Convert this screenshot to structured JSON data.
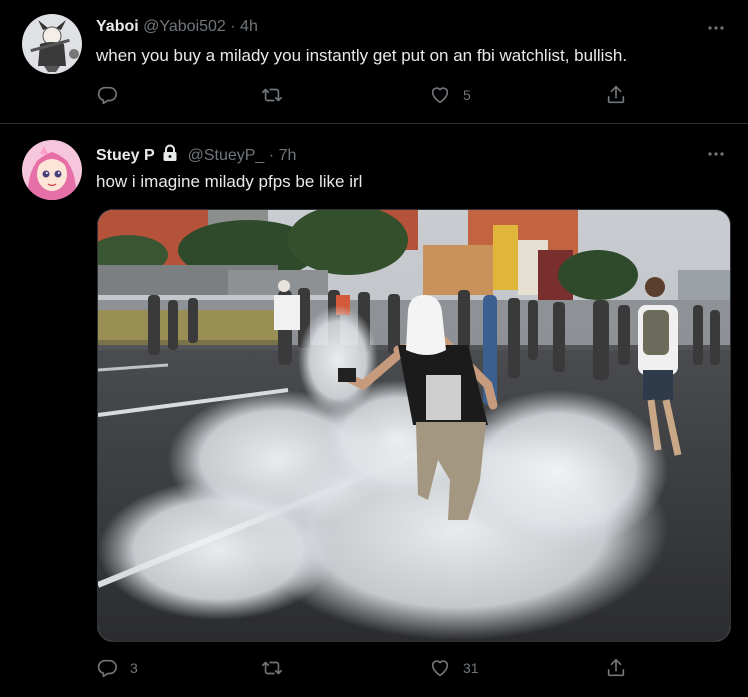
{
  "tweets": [
    {
      "author_name": "Yaboi",
      "handle": "@Yaboi502",
      "separator": "·",
      "time": "4h",
      "text": "when you buy a milady you instantly get put on an fbi watchlist, bullish.",
      "counts": {
        "reply": "",
        "retweet": "",
        "like": "5",
        "share": ""
      },
      "verified_lock": false
    },
    {
      "author_name": "Stuey P",
      "handle": "@StueyP_",
      "separator": "·",
      "time": "7h",
      "text": "how i imagine milady pfps be like irl",
      "counts": {
        "reply": "3",
        "retweet": "",
        "like": "31",
        "share": ""
      },
      "verified_lock": true
    }
  ],
  "icons": {
    "more": "more-horizontal-icon",
    "reply": "reply-icon",
    "retweet": "retweet-icon",
    "like": "heart-icon",
    "share": "share-icon",
    "lock": "lock-icon"
  },
  "colors": {
    "background": "#000000",
    "text_primary": "#e7e9ea",
    "text_secondary": "#71767b",
    "divider": "#2f3336"
  }
}
